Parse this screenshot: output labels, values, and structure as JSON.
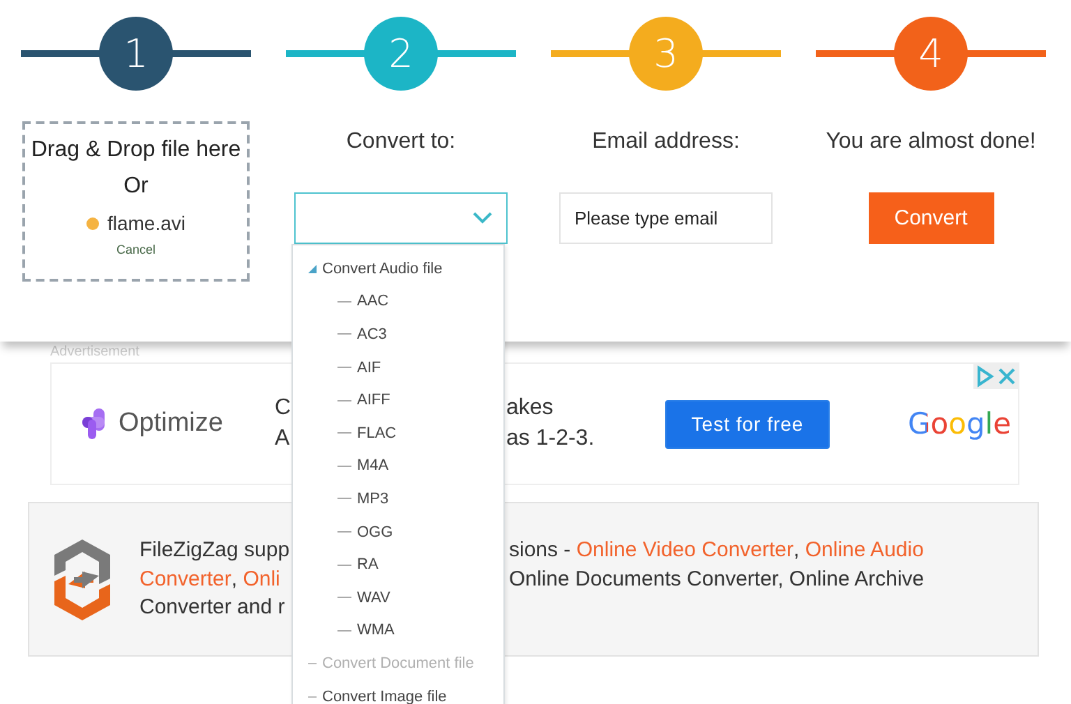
{
  "steps": [
    {
      "number": "1",
      "color": "#2a5470",
      "kind": "dropzone",
      "drop_text": "Drag & Drop file here",
      "or_text": "Or",
      "file": "flame.avi",
      "cancel": "Cancel"
    },
    {
      "number": "2",
      "color": "#1cb5c6",
      "kind": "select",
      "label": "Convert to:"
    },
    {
      "number": "3",
      "color": "#f4ac1e",
      "kind": "email",
      "label": "Email address:",
      "placeholder": "Please type email"
    },
    {
      "number": "4",
      "color": "#f2621a",
      "kind": "button",
      "label": "You are almost done!",
      "button": "Convert"
    }
  ],
  "dropdown": {
    "groups": [
      {
        "label": "Convert Audio file",
        "expanded": true,
        "disabled": false,
        "children": [
          "AAC",
          "AC3",
          "AIF",
          "AIFF",
          "FLAC",
          "M4A",
          "MP3",
          "OGG",
          "RA",
          "WAV",
          "WMA"
        ]
      },
      {
        "label": "Convert Document file",
        "expanded": false,
        "disabled": true
      },
      {
        "label": "Convert Image file",
        "expanded": false,
        "disabled": false
      }
    ]
  },
  "ad": {
    "caption": "Advertisement",
    "brand": "Optimize",
    "text_left": [
      "C",
      "A"
    ],
    "text_right": [
      "akes",
      "as 1-2-3."
    ],
    "button": "Test for free",
    "logo": "Google"
  },
  "info": {
    "lines_left": [
      [
        {
          "text": "FileZigZag supp",
          "link": false
        }
      ],
      [
        {
          "text": "Converter",
          "link": true
        },
        {
          "text": ", ",
          "link": false
        },
        {
          "text": "Onli",
          "link": true
        }
      ],
      [
        {
          "text": "Converter and r",
          "link": false
        }
      ]
    ],
    "lines_right": [
      [
        {
          "text": "sions - ",
          "link": false
        },
        {
          "text": "Online Video Converter",
          "link": true
        },
        {
          "text": ", ",
          "link": false
        },
        {
          "text": "Online Audio",
          "link": true
        }
      ],
      [
        {
          "text": "Online Documents Converter, Online Archive",
          "link": false
        }
      ]
    ]
  }
}
